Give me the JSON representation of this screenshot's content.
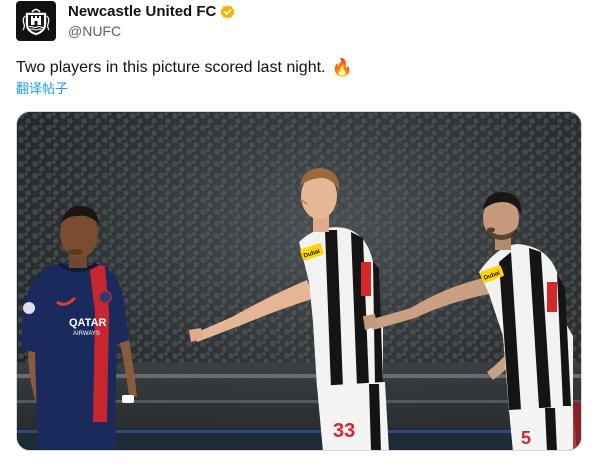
{
  "tweet": {
    "display_name": "Newcastle United FC",
    "handle": "@NUFC",
    "text": "Two players in this picture scored last night.",
    "emoji": "🔥",
    "translate_label": "翻译帖子",
    "verified_icon": "verified-badge-icon",
    "avatar_icon": "newcastle-crest-icon",
    "colors": {
      "handle": "#536471",
      "link": "#1d9bf0",
      "verified": "#f4b400"
    }
  },
  "media": {
    "sponsor_left": "QATAR",
    "sponsor_left_sub": "AIRWAYS",
    "sleeve_sponsor_a": "Dubai",
    "sleeve_sponsor_b": "Dubai",
    "number_center": "33",
    "number_right": "5"
  }
}
